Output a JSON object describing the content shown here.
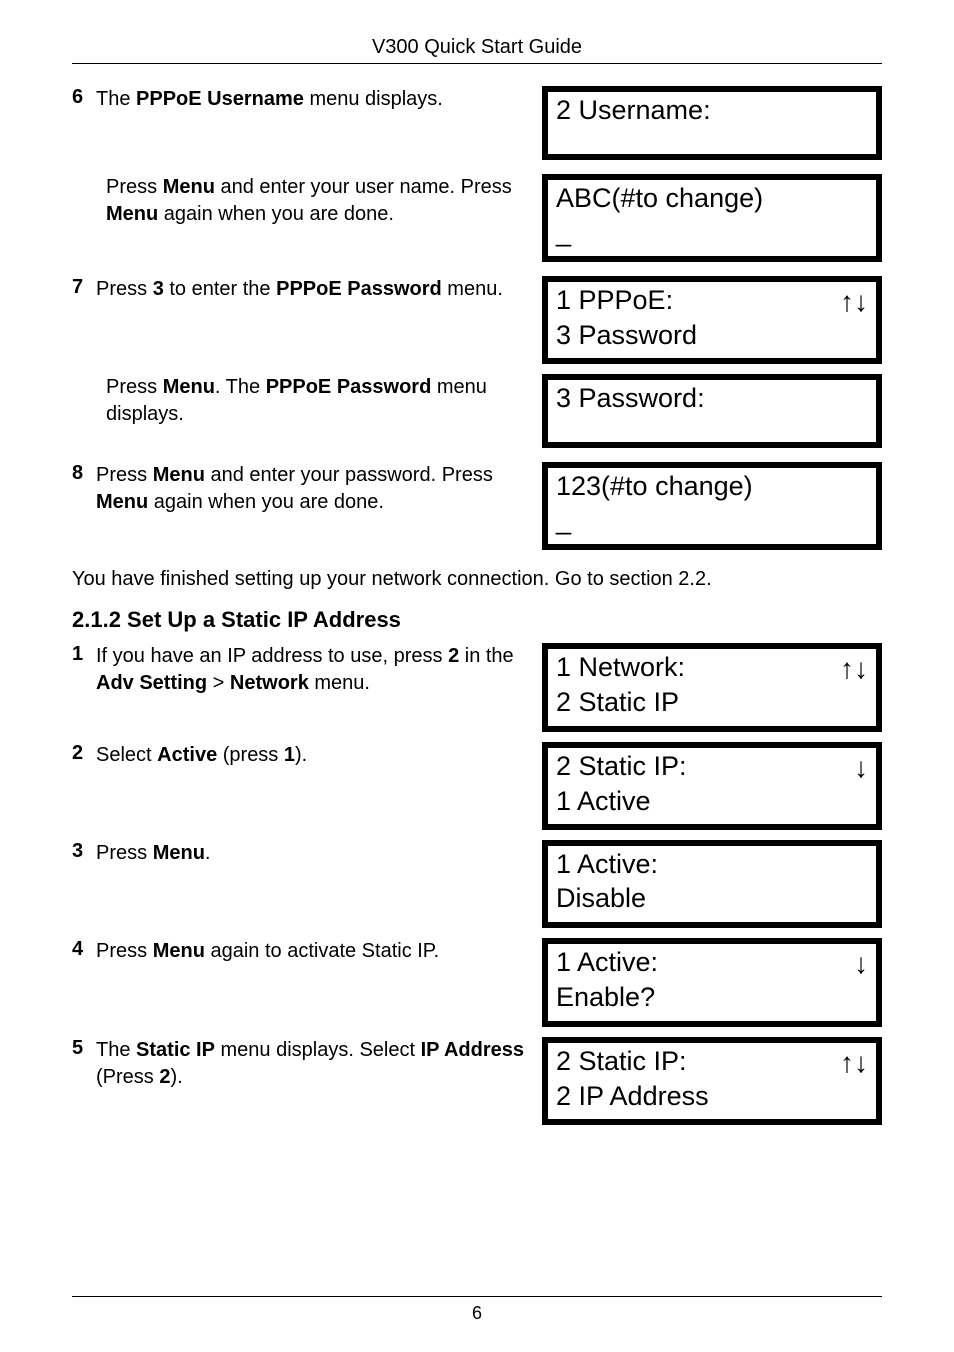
{
  "header": {
    "title": "V300 Quick Start Guide"
  },
  "s1": {
    "items": [
      {
        "num": "6",
        "html": "The <b>PPPoE Username</b> menu displays."
      },
      {
        "indent": true,
        "html": "Press <b>Menu</b> and enter your user name. Press <b>Menu</b> again when you are done."
      },
      {
        "num": "7",
        "html": "Press <b>3</b> to enter the <b>PPPoE Password</b> menu."
      },
      {
        "indent": true,
        "html": "Press <b>Menu</b>. The <b>PPPoE Password</b> menu displays."
      },
      {
        "num": "8",
        "html": "Press <b>Menu</b> and enter your password. Press <b>Menu</b> again when you are done."
      }
    ],
    "lcds": [
      {
        "line1": "2 Username:",
        "line2": ""
      },
      {
        "line1": "ABC(#to change)",
        "line2": "_"
      },
      {
        "line1": "1 PPPoE:",
        "arrow": "↑↓",
        "line2": "3 Password"
      },
      {
        "line1": "3 Password:",
        "line2": ""
      },
      {
        "line1": "123(#to change)",
        "line2": "_"
      }
    ]
  },
  "para": "You have finished setting up your network connection. Go to section 2.2.",
  "heading": "2.1.2 Set Up a Static IP Address",
  "s2": {
    "items": [
      {
        "num": "1",
        "html": "If you have an IP address to use, press <b>2</b> in the <b>Adv Setting</b> > <b>Network</b> menu."
      },
      {
        "num": "2",
        "html": "Select <b>Active</b> (press <b>1</b>)."
      },
      {
        "num": "3",
        "html": "Press <b>Menu</b>."
      },
      {
        "num": "4",
        "html": "Press <b>Menu</b> again to activate Static IP."
      },
      {
        "num": "5",
        "html": "The <b>Static IP</b> menu displays. Select <b>IP Address</b> (Press <b>2</b>)."
      }
    ],
    "lcds": [
      {
        "line1": "1 Network:",
        "arrow": "↑↓",
        "line2": "2 Static IP"
      },
      {
        "line1": "2 Static IP:",
        "arrow": "↓",
        "line2": "1 Active"
      },
      {
        "line1": "1 Active:",
        "line2": "Disable"
      },
      {
        "line1": "1 Active:",
        "arrow": "↓",
        "line2": "Enable?"
      },
      {
        "line1": "2 Static IP:",
        "arrow": "↑↓",
        "line2": "2 IP Address"
      }
    ]
  },
  "pageNumber": "6"
}
